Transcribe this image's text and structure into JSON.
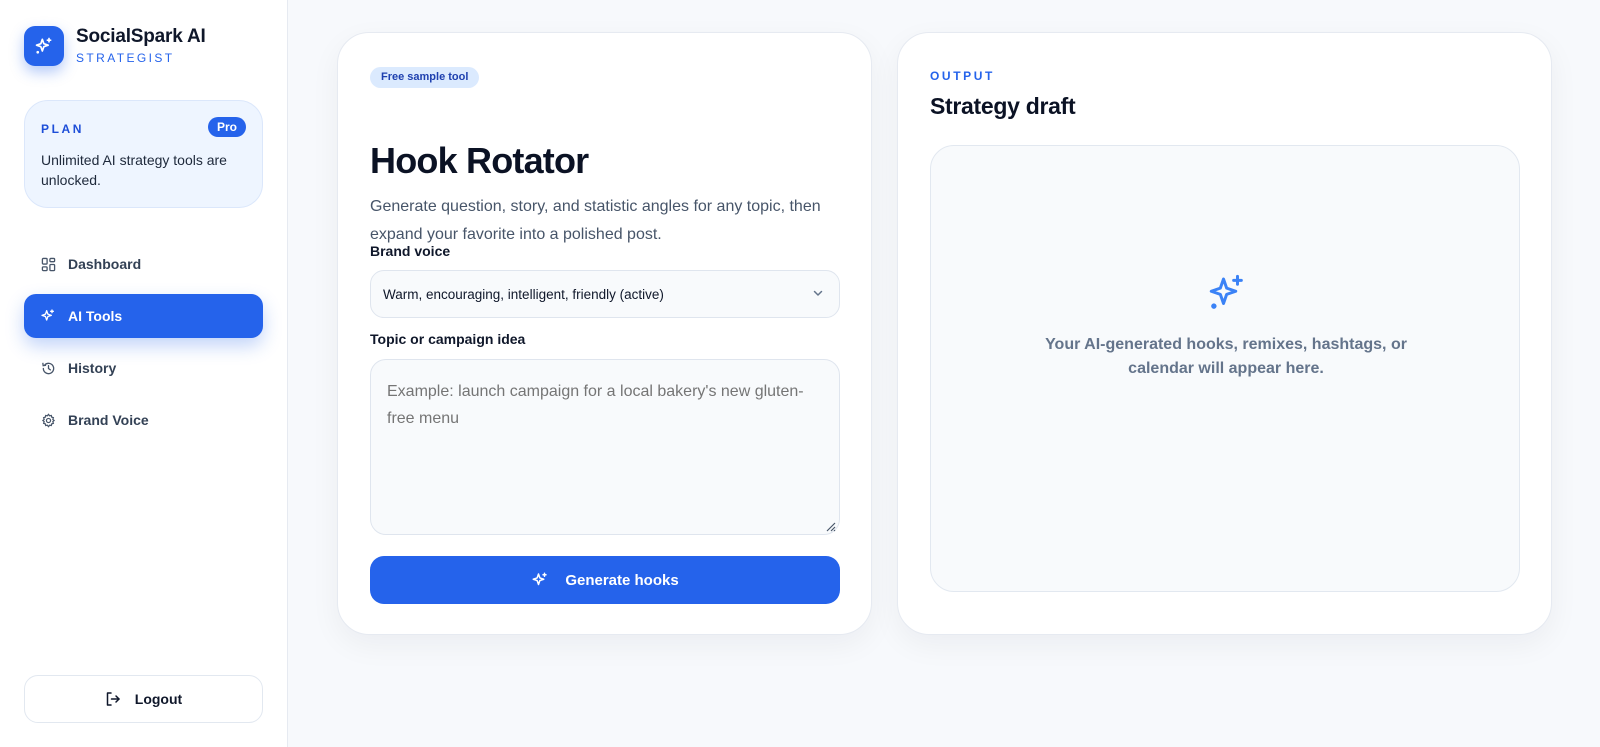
{
  "brand": {
    "name": "SocialSpark AI",
    "subtitle": "STRATEGIST"
  },
  "plan": {
    "label": "PLAN",
    "badge": "Pro",
    "description": "Unlimited AI strategy tools are unlocked."
  },
  "nav": [
    {
      "label": "Dashboard",
      "icon": "dashboard-icon"
    },
    {
      "label": "AI Tools",
      "icon": "sparkle-icon",
      "active": true
    },
    {
      "label": "History",
      "icon": "history-icon"
    },
    {
      "label": "Brand Voice",
      "icon": "gear-icon"
    }
  ],
  "logout": {
    "label": "Logout"
  },
  "tool": {
    "chip": "Free sample tool",
    "title": "Hook Rotator",
    "description": "Generate question, story, and statistic angles for any topic, then expand your favorite into a polished post.",
    "brand_voice_label": "Brand voice",
    "brand_voice_value": "Warm, encouraging, intelligent, friendly (active)",
    "topic_label": "Topic or campaign idea",
    "topic_placeholder": "Example: launch campaign for a local bakery's new gluten-free menu",
    "generate_label": "Generate hooks"
  },
  "output": {
    "label": "OUTPUT",
    "title": "Strategy draft",
    "empty_text": "Your AI-generated hooks, remixes, hashtags, or calendar will appear here."
  },
  "colors": {
    "accent": "#2563eb",
    "background": "#f7f9fc"
  }
}
